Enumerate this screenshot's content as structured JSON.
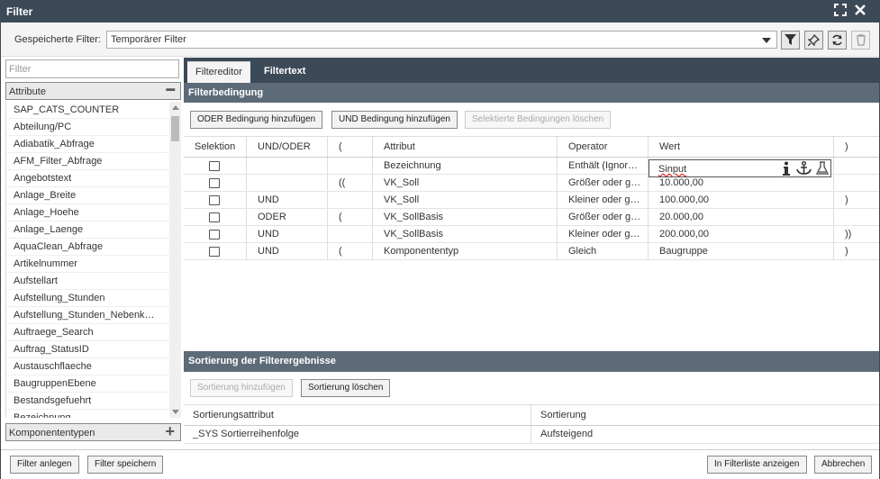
{
  "window": {
    "title": "Filter"
  },
  "saved_filter": {
    "label": "Gespeicherte Filter:",
    "value": "Temporärer Filter"
  },
  "left": {
    "search_placeholder": "Filter",
    "attributes_header": "Attribute",
    "attributes": [
      "SAP_CATS_COUNTER",
      "Abteilung/PC",
      "Adiabatik_Abfrage",
      "AFM_Filter_Abfrage",
      "Angebotstext",
      "Anlage_Breite",
      "Anlage_Hoehe",
      "Anlage_Laenge",
      "AquaClean_Abfrage",
      "Artikelnummer",
      "Aufstellart",
      "Aufstellung_Stunden",
      "Aufstellung_Stunden_Nebenk…",
      "Auftraege_Search",
      "Auftrag_StatusID",
      "Austauschflaeche",
      "BaugruppenEbene",
      "Bestandsgefuehrt",
      "Bezeichnung"
    ],
    "components_header": "Komponententypen"
  },
  "tabs": [
    {
      "label": "Filtereditor",
      "active": true
    },
    {
      "label": "Filtertext",
      "active": false
    }
  ],
  "filter_section": {
    "title": "Filterbedingung",
    "buttons": {
      "add_or": "ODER Bedingung hinzufügen",
      "add_and": "UND Bedingung hinzufügen",
      "delete_selected": "Selektierte Bedingungen löschen"
    },
    "columns": [
      "Selektion",
      "UND/ODER",
      "(",
      "Attribut",
      "Operator",
      "Wert",
      ")"
    ],
    "rows": [
      {
        "op": "",
        "open": "",
        "attr": "Bezeichnung",
        "operator": "Enthält (Ignor…",
        "value": "Sinput",
        "close": ""
      },
      {
        "op": "",
        "open": "((",
        "attr": "VK_Soll",
        "operator": "Größer oder g…",
        "value": "10.000,00",
        "close": ""
      },
      {
        "op": "UND",
        "open": "",
        "attr": "VK_Soll",
        "operator": "Kleiner oder g…",
        "value": "100.000,00",
        "close": ")"
      },
      {
        "op": "ODER",
        "open": "(",
        "attr": "VK_SollBasis",
        "operator": "Größer oder g…",
        "value": "20.000,00",
        "close": ""
      },
      {
        "op": "UND",
        "open": "",
        "attr": "VK_SollBasis",
        "operator": "Kleiner oder g…",
        "value": "200.000,00",
        "close": "))"
      },
      {
        "op": "UND",
        "open": "(",
        "attr": "Komponententyp",
        "operator": "Gleich",
        "value": "Baugruppe",
        "close": ")"
      }
    ]
  },
  "sort_section": {
    "title": "Sortierung der Filterergebnisse",
    "buttons": {
      "add": "Sortierung hinzufügen",
      "delete": "Sortierung löschen"
    },
    "columns": [
      "Sortierungsattribut",
      "Sortierung"
    ],
    "rows": [
      {
        "attr": "_SYS Sortierreihenfolge",
        "order": "Aufsteigend"
      }
    ]
  },
  "footer": {
    "create": "Filter anlegen",
    "save": "Filter speichern",
    "show": "In Filterliste anzeigen",
    "cancel": "Abbrechen"
  },
  "colors": {
    "titlebar": "#3c4a57",
    "section_header": "#5d6b78"
  }
}
